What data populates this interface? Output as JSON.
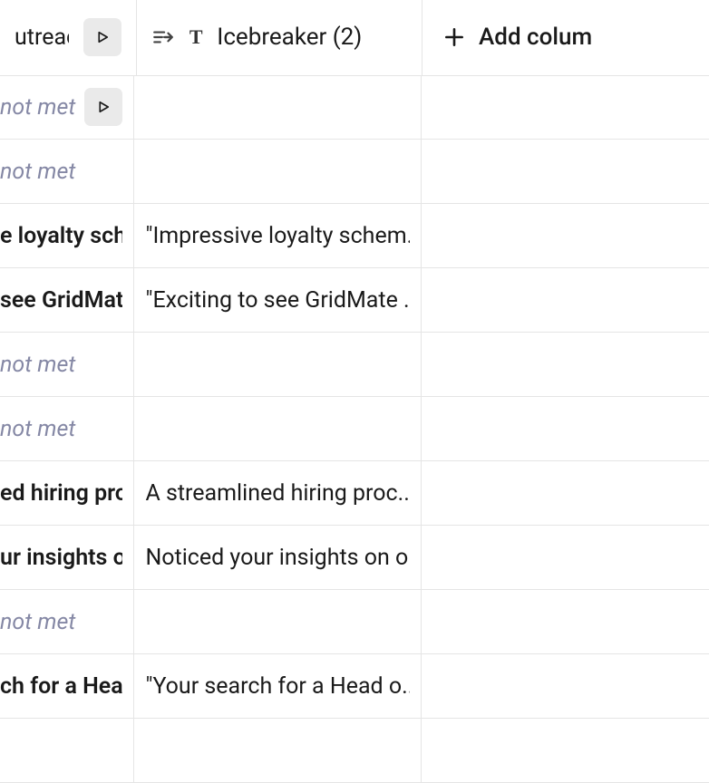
{
  "columns": {
    "a": {
      "label": "utreach L."
    },
    "b": {
      "label": "Icebreaker (2)"
    },
    "c": {
      "label": "Add colum"
    }
  },
  "not_met_label": "not met",
  "rows": [
    {
      "a": {
        "type": "notmet",
        "has_play": true
      },
      "b": {
        "type": "empty"
      }
    },
    {
      "a": {
        "type": "notmet"
      },
      "b": {
        "type": "empty"
      }
    },
    {
      "a": {
        "type": "bold",
        "text": "e loyalty sche"
      },
      "b": {
        "type": "text",
        "text": "\"Impressive loyalty schem..."
      }
    },
    {
      "a": {
        "type": "bold",
        "text": " see GridMat"
      },
      "b": {
        "type": "text",
        "text": "\"Exciting to see GridMate ..."
      }
    },
    {
      "a": {
        "type": "notmet"
      },
      "b": {
        "type": "empty"
      }
    },
    {
      "a": {
        "type": "notmet"
      },
      "b": {
        "type": "empty"
      }
    },
    {
      "a": {
        "type": "bold",
        "text": "ed hiring pro"
      },
      "b": {
        "type": "text",
        "text": "A streamlined hiring proc..."
      }
    },
    {
      "a": {
        "type": "bold",
        "text": "ur insights on"
      },
      "b": {
        "type": "text",
        "text": "Noticed your insights on o..."
      }
    },
    {
      "a": {
        "type": "notmet"
      },
      "b": {
        "type": "empty"
      }
    },
    {
      "a": {
        "type": "bold",
        "text": "ch for a Head"
      },
      "b": {
        "type": "text",
        "text": "\"Your search for a Head o..."
      }
    },
    {
      "a": {
        "type": "empty"
      },
      "b": {
        "type": "empty"
      }
    }
  ]
}
